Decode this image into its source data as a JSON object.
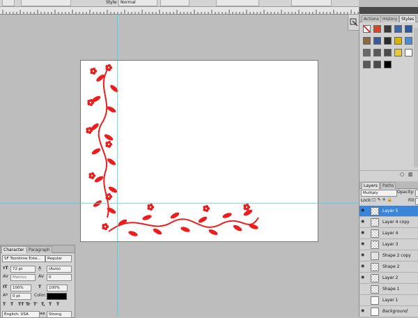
{
  "options_bar": {
    "style_label": "Style:",
    "style_value": "Normal"
  },
  "panels_top": {
    "tabs": [
      "Actions",
      "History",
      "Styles"
    ],
    "active_tab": "Styles",
    "swatches": [
      "#ffffff",
      "#d2462a",
      "#3a3a3a",
      "#3a6aa8",
      "#2c5aa0",
      "#8a6a3a",
      "#3a5a9a",
      "#2b2b2b",
      "#d9b200",
      "#4a8ad0",
      "#6a6a6a",
      "#5a5a5a",
      "#4a4a4a",
      "#e6c83a",
      "#ffffff",
      "#5a5a5a",
      "#4a4a4a",
      "#000000"
    ]
  },
  "layers_panel": {
    "tabs": [
      "Layers",
      "Paths"
    ],
    "active_tab": "Layers",
    "blend_mode": "Multiply",
    "opacity_label": "Opacity:",
    "lock_label": "Lock:",
    "fill_label": "Fill:",
    "layers": [
      {
        "name": "Layer 5",
        "selected": true,
        "visible": true,
        "thumb": "transparent"
      },
      {
        "name": "Layer 4 copy",
        "selected": false,
        "visible": true,
        "thumb": "transparent"
      },
      {
        "name": "Layer 4",
        "selected": false,
        "visible": true,
        "thumb": "transparent"
      },
      {
        "name": "Layer 3",
        "selected": false,
        "visible": true,
        "thumb": "transparent"
      },
      {
        "name": "Shape 2 copy",
        "selected": false,
        "visible": true,
        "thumb": "transparent"
      },
      {
        "name": "Shape 2",
        "selected": false,
        "visible": true,
        "thumb": "transparent"
      },
      {
        "name": "Layer 2",
        "selected": false,
        "visible": true,
        "thumb": "transparent"
      },
      {
        "name": "Shape 1",
        "selected": false,
        "visible": false,
        "thumb": "transparent"
      },
      {
        "name": "Layer 1",
        "selected": false,
        "visible": false,
        "thumb": "white"
      },
      {
        "name": "Background",
        "selected": false,
        "visible": true,
        "thumb": "white"
      }
    ]
  },
  "character_panel": {
    "tabs": [
      "Character",
      "Paragraph"
    ],
    "active_tab": "Character",
    "font_family": "SF Toontime Exte...",
    "font_style": "Regular",
    "font_size": "72 pt",
    "leading": "(Auto)",
    "kerning": "Metrics",
    "tracking": "0",
    "vertical_scale": "100%",
    "horizontal_scale": "100%",
    "baseline_shift": "0 pt",
    "color_label": "Color:",
    "color_value": "#000000",
    "style_buttons": [
      "T",
      "T",
      "TT",
      "Tr",
      "T'",
      "T,",
      "T",
      "T"
    ],
    "language": "English: USA",
    "antialias_icon_text": "aa",
    "antialias": "Strong"
  },
  "artwork": {
    "ornament_color": "#ee1c1c"
  }
}
